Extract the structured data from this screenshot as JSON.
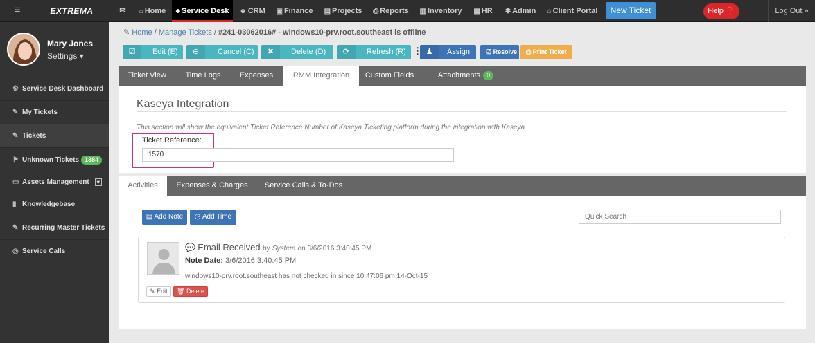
{
  "topbar": {
    "menu_glyph": "≡",
    "logo": "EXTREMA",
    "nav": [
      {
        "label": "Home",
        "icon": "home-icon",
        "glyph": "⌂"
      },
      {
        "label": "Service Desk",
        "icon": "sitemap-icon",
        "glyph": "♣"
      },
      {
        "label": "CRM",
        "icon": "users-icon",
        "glyph": "☻"
      },
      {
        "label": "Finance",
        "icon": "money-icon",
        "glyph": "▣"
      },
      {
        "label": "Projects",
        "icon": "list-icon",
        "glyph": "▤"
      },
      {
        "label": "Reports",
        "icon": "print-icon",
        "glyph": "⎙"
      },
      {
        "label": "Inventory",
        "icon": "barcode-icon",
        "glyph": "▥"
      },
      {
        "label": "HR",
        "icon": "building-icon",
        "glyph": "▦"
      },
      {
        "label": "Admin",
        "icon": "gear-icon",
        "glyph": "✱"
      },
      {
        "label": "Client Portal",
        "icon": "home-icon",
        "glyph": "⌂"
      }
    ],
    "inbox_glyph": "✉",
    "new_ticket": "New Ticket",
    "help": "Help ❓",
    "logout": "Log Out »"
  },
  "sidebar": {
    "user_name": "Mary Jones",
    "settings": "Settings ▾",
    "items": [
      {
        "label": "Service Desk Dashboard",
        "glyph": "⚙"
      },
      {
        "label": "My Tickets",
        "glyph": "✎"
      },
      {
        "label": "Tickets",
        "glyph": "✎"
      },
      {
        "label": "Unknown Tickets",
        "glyph": "⚑",
        "badge": "1384"
      },
      {
        "label": "Assets Management",
        "glyph": "▭",
        "expand": "▾"
      },
      {
        "label": "Knowledgebase",
        "glyph": "▮"
      },
      {
        "label": "Recurring Master Tickets",
        "glyph": "✎"
      },
      {
        "label": "Service Calls",
        "glyph": "◎"
      }
    ]
  },
  "breadcrumb": {
    "home": "Home",
    "manage": "Manage Tickets",
    "current": "#241-03062016# - windows10-prv.root.southeast is offline",
    "sep": "/"
  },
  "toolbar": {
    "edit": "Edit (E)",
    "cancel": "Cancel (C)",
    "delete": "Delete (D)",
    "refresh": "Refresh (R)",
    "more": "⋮",
    "assign": "Assign",
    "resolve": "Resolve",
    "print": "Print Ticket",
    "icons": {
      "edit": "☑",
      "cancel": "⊖",
      "delete": "✖",
      "refresh": "⟳",
      "assign": "♟",
      "resolve": "☑",
      "print": "⎙"
    }
  },
  "tabs": [
    {
      "label": "Ticket View"
    },
    {
      "label": "Time Logs"
    },
    {
      "label": "Expenses"
    },
    {
      "label": "RMM Integration",
      "active": true
    },
    {
      "label": "Custom Fields"
    },
    {
      "label": "Attachments",
      "badge": "0"
    }
  ],
  "integration": {
    "title": "Kaseya Integration",
    "description": "This section will show the equivalent Ticket Reference Number of Kaseya Ticketing platform during the integration with Kaseya.",
    "ref_label": "Ticket Reference:",
    "ref_value": "1570"
  },
  "tabs2": [
    {
      "label": "Activities",
      "active": true
    },
    {
      "label": "Expenses & Charges"
    },
    {
      "label": "Service Calls & To-Dos"
    }
  ],
  "activities": {
    "add_note": "Add Note",
    "add_time": "Add Time",
    "quick_search_placeholder": "Quick Search",
    "note": {
      "title": "Email Received",
      "by": "by",
      "author": "System",
      "on": "on 3/6/2016 3:40:45 PM",
      "date_label": "Note Date:",
      "date_value": "3/6/2016 3:40:45 PM",
      "body": "windows10-prv.root.southeast has not checked in since 10:47:06 pm 14-Oct-15",
      "edit": "Edit",
      "delete": "Delete"
    }
  },
  "colors": {
    "accent_blue": "#3c74b6",
    "teal": "#49b6c0",
    "danger": "#d9262b",
    "highlight": "#c2348c"
  }
}
